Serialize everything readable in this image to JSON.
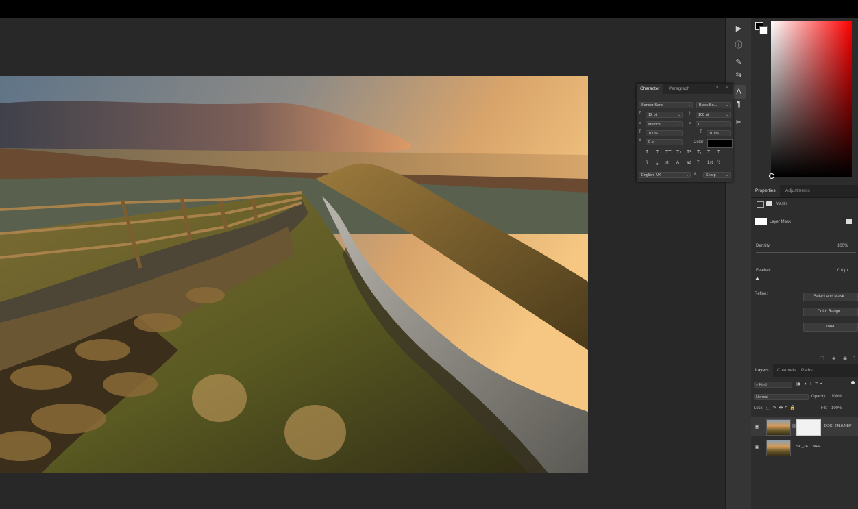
{
  "toolbar_icons": [
    "play-icon",
    "info-icon",
    "brush-settings-icon",
    "adjust-sliders-icon",
    "character-panel-icon",
    "paragraph-icon",
    "tools-icon"
  ],
  "character_panel": {
    "tabs": [
      "Character",
      "Paragraph"
    ],
    "font_family": "Sonder Sans",
    "font_style": "Black Bo...",
    "font_size": "12 pt",
    "leading": "108 pt",
    "kerning": "Metrics",
    "tracking": "0",
    "vertical_scale": "100%",
    "horizontal_scale": "101%",
    "baseline_shift": "0 pt",
    "color_label": "Color:",
    "color": "#000000",
    "language": "English: UK",
    "antialias": "Sharp",
    "glyph_row1": [
      "T",
      "T",
      "TT",
      "Tт",
      "T¹",
      "T₁",
      "T",
      "T"
    ],
    "glyph_row2": [
      "fi",
      "ꝺ",
      "st",
      "A",
      "ad",
      "T",
      "1st",
      "½"
    ]
  },
  "properties": {
    "tabs": [
      "Properties",
      "Adjustments"
    ],
    "masks_label": "Masks",
    "layer_mask_label": "Layer Mask",
    "density_label": "Density:",
    "density_value": "100%",
    "density_fraction": 1.0,
    "feather_label": "Feather:",
    "feather_value": "0.0 px",
    "refine_label": "Refine:",
    "select_and_mask": "Select and Mask...",
    "color_range": "Color Range...",
    "invert": "Invert"
  },
  "layers": {
    "tabs": [
      "Layers",
      "Channels",
      "Paths"
    ],
    "filter_kind": "Kind",
    "blend_mode": "Normal",
    "opacity_label": "Opacity:",
    "opacity_value": "100%",
    "lock_label": "Lock:",
    "fill_label": "Fill:",
    "fill_value": "100%",
    "items": [
      {
        "name": "DSC_2416.NEF",
        "has_mask": true
      },
      {
        "name": "DSC_2417.NEF",
        "has_mask": false
      }
    ]
  },
  "colors": {
    "picker_hue": "#ff0000",
    "foreground": "#000000",
    "background": "#ffffff"
  }
}
